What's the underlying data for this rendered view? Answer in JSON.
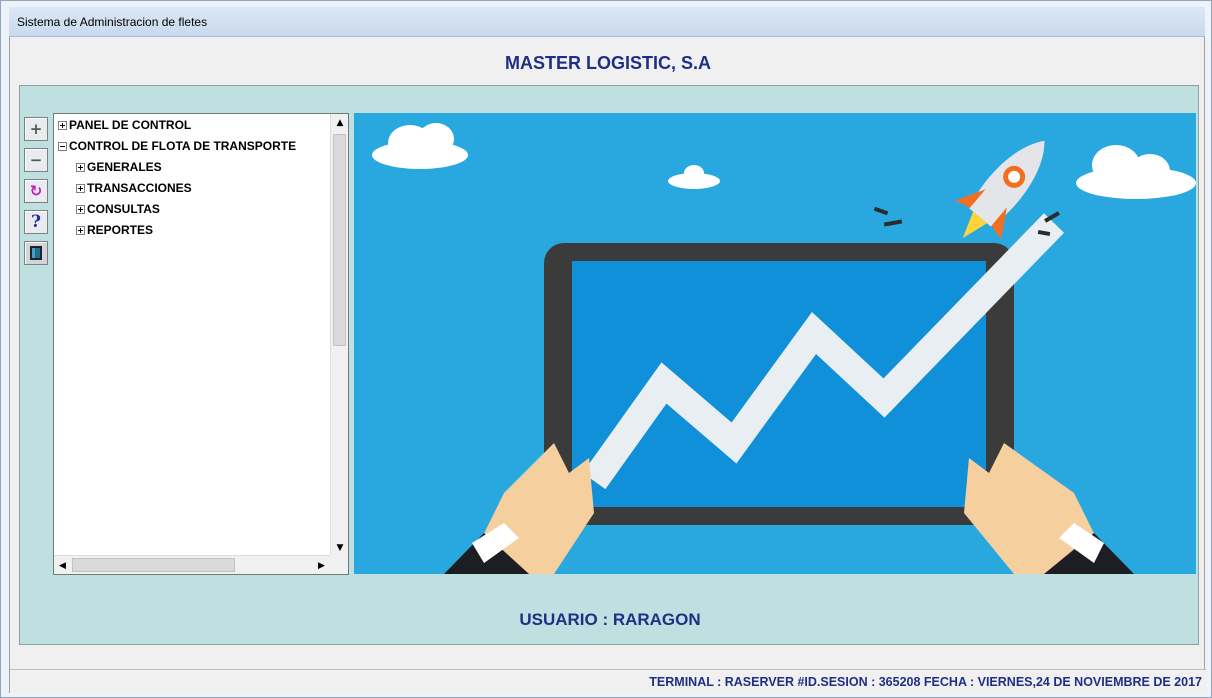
{
  "window": {
    "title": "Sistema de Administracion de fletes"
  },
  "header": {
    "company": "MASTER LOGISTIC, S.A"
  },
  "toolbar": {
    "buttons": [
      {
        "icon": "expand-all-icon",
        "glyph": "+"
      },
      {
        "icon": "collapse-all-icon",
        "glyph": "−"
      },
      {
        "icon": "refresh-icon",
        "glyph": "↻"
      },
      {
        "icon": "help-icon",
        "glyph": "?"
      },
      {
        "icon": "exit-door-icon",
        "glyph": ""
      }
    ]
  },
  "tree": {
    "nodes": [
      {
        "label": "PANEL DE CONTROL",
        "state": "collapsed",
        "level": 0
      },
      {
        "label": "CONTROL DE FLOTA DE TRANSPORTE",
        "state": "expanded",
        "level": 0
      },
      {
        "label": "GENERALES",
        "state": "collapsed",
        "level": 1
      },
      {
        "label": "TRANSACCIONES",
        "state": "collapsed",
        "level": 1
      },
      {
        "label": "CONSULTAS",
        "state": "collapsed",
        "level": 1
      },
      {
        "label": "REPORTES",
        "state": "collapsed",
        "level": 1
      }
    ]
  },
  "main": {
    "user_label": "USUARIO : RARAGON"
  },
  "status": {
    "text": "TERMINAL : RASERVER #ID.SESION : 365208 FECHA : VIERNES,24 DE NOVIEMBRE DE 2017"
  },
  "colors": {
    "accent_text": "#1f2f86",
    "panel_bg": "#bfe0e0",
    "illustration_bg": "#29a8e0"
  }
}
